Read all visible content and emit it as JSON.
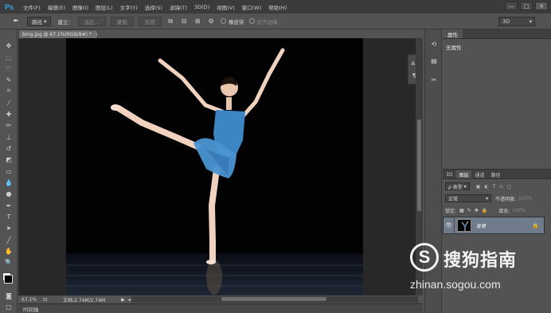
{
  "app": {
    "logo": "Ps"
  },
  "menu": [
    "文件(F)",
    "编辑(E)",
    "图像(I)",
    "图层(L)",
    "文字(Y)",
    "选择(S)",
    "滤镜(T)",
    "3D(D)",
    "视图(V)",
    "窗口(W)",
    "帮助(H)"
  ],
  "window_buttons": [
    "—",
    "□",
    "✕"
  ],
  "options": {
    "mode": "路径",
    "build_label": "建立：",
    "selection_btn": "选区...",
    "mask_btn": "蒙版",
    "shape_btn": "形状",
    "rubber_band": "橡皮带",
    "align_edges": "对齐边缘",
    "workspace": "3D"
  },
  "document": {
    "tab_title": "bmg.jpg @ 67.1%(RGB/8#) *",
    "zoom": "67.1%",
    "doc_size": "文档:2.74M/2.74M"
  },
  "timeline_label": "时间轴",
  "properties": {
    "tab": "属性",
    "content": "无属性"
  },
  "layers": {
    "tabs": [
      "3D",
      "图层",
      "通道",
      "路径"
    ],
    "filter_kind": "ρ 类型",
    "blend_mode": "正常",
    "opacity_label": "不透明度:",
    "opacity_value": "100%",
    "lock_label": "锁定:",
    "fill_label": "填充:",
    "fill_value": "100%",
    "layer_name": "背景"
  },
  "watermark": {
    "brand": "搜狗指南",
    "url": "zhinan.sogou.com",
    "logo_letter": "S"
  },
  "colors": {
    "accent": "#35a9e9",
    "leotard": "#3d86c4",
    "panel": "#535353",
    "menubar": "#3b3b3b"
  }
}
